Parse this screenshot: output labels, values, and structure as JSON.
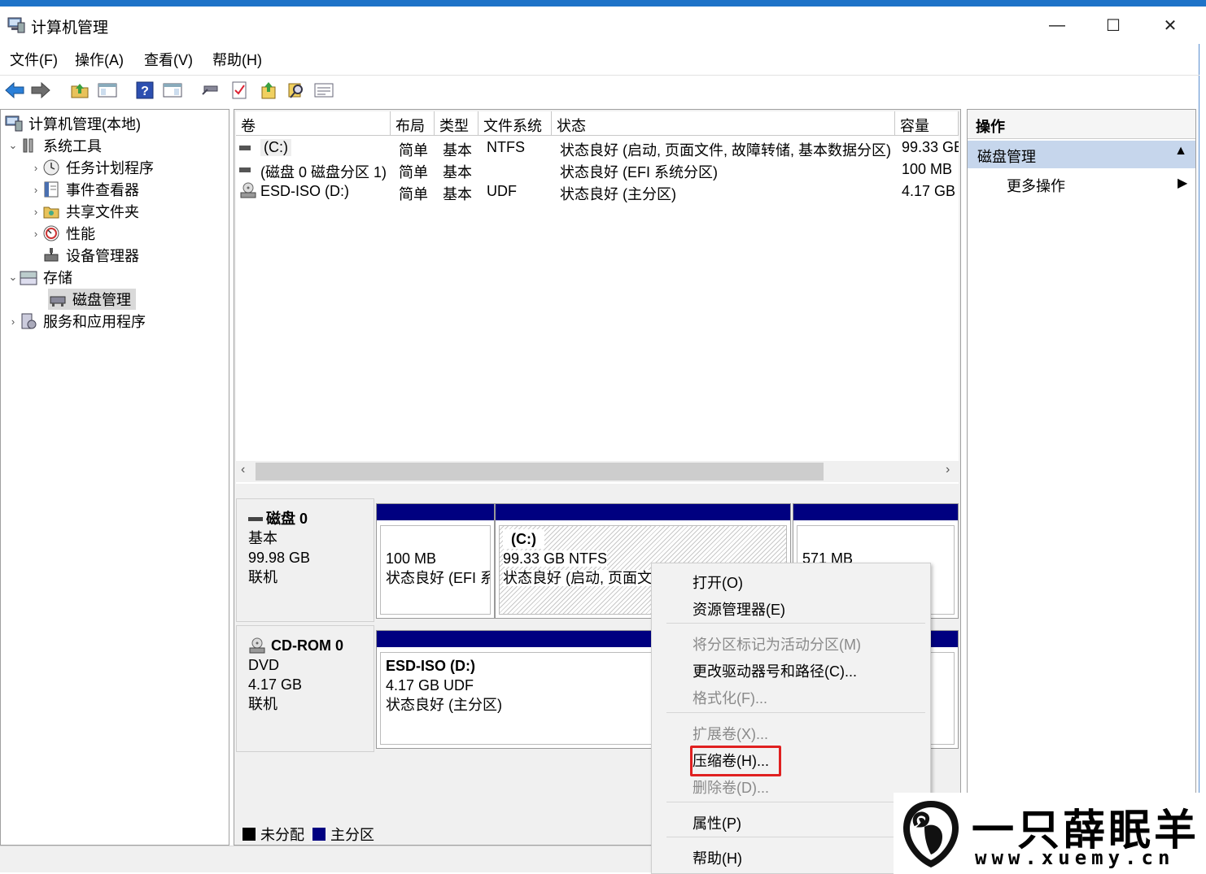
{
  "window": {
    "title": "计算机管理",
    "controls": {
      "minimize": "—",
      "maximize": "☐",
      "close": "✕"
    }
  },
  "menu": [
    "文件(F)",
    "操作(A)",
    "查看(V)",
    "帮助(H)"
  ],
  "toolbar_icons": [
    "back-arrow-icon",
    "forward-arrow-icon",
    "up-folder-icon",
    "show-hide-tree-icon",
    "help-icon",
    "properties-pane-icon",
    "connect-icon",
    "checklist-icon",
    "export-icon",
    "search-icon",
    "view-icon"
  ],
  "tree": {
    "root": "计算机管理(本地)",
    "items": [
      {
        "label": "系统工具",
        "level": 1,
        "expanded": true
      },
      {
        "label": "任务计划程序",
        "level": 2,
        "expanded": false
      },
      {
        "label": "事件查看器",
        "level": 2,
        "expanded": false
      },
      {
        "label": "共享文件夹",
        "level": 2,
        "expanded": false
      },
      {
        "label": "性能",
        "level": 2,
        "expanded": false
      },
      {
        "label": "设备管理器",
        "level": 2,
        "expanded": null
      },
      {
        "label": "存储",
        "level": 1,
        "expanded": true
      },
      {
        "label": "磁盘管理",
        "level": 2,
        "expanded": null,
        "selected": true
      },
      {
        "label": "服务和应用程序",
        "level": 1,
        "expanded": false
      }
    ]
  },
  "volumes": {
    "headers": [
      "卷",
      "布局",
      "类型",
      "文件系统",
      "状态",
      "容量"
    ],
    "rows": [
      {
        "vol": "(C:)",
        "layout": "简单",
        "type": "基本",
        "fs": "NTFS",
        "status": "状态良好 (启动, 页面文件, 故障转储, 基本数据分区)",
        "cap": "99.33 GE"
      },
      {
        "vol": "(磁盘 0 磁盘分区 1)",
        "layout": "简单",
        "type": "基本",
        "fs": "",
        "status": "状态良好 (EFI 系统分区)",
        "cap": "100 MB"
      },
      {
        "vol": "ESD-ISO (D:)",
        "layout": "简单",
        "type": "基本",
        "fs": "UDF",
        "status": "状态良好 (主分区)",
        "cap": "4.17 GB"
      }
    ]
  },
  "disks": [
    {
      "name": "磁盘 0",
      "kind": "基本",
      "size": "99.98 GB",
      "state": "联机",
      "partitions": [
        {
          "title": "",
          "line1": "100 MB",
          "line2": "状态良好 (EFI 系"
        },
        {
          "title": "(C:)",
          "line1": "99.33 GB NTFS",
          "line2": "状态良好 (启动, 页面文"
        },
        {
          "title": "",
          "line1": "571 MB",
          "line2": ""
        }
      ]
    },
    {
      "name": "CD-ROM 0",
      "kind": "DVD",
      "size": "4.17 GB",
      "state": "联机",
      "partitions": [
        {
          "title": "ESD-ISO  (D:)",
          "line1": "4.17 GB UDF",
          "line2": "状态良好 (主分区)"
        }
      ]
    }
  ],
  "legend": [
    {
      "label": "未分配",
      "color": "#000000"
    },
    {
      "label": "主分区",
      "color": "#000080"
    }
  ],
  "actions": {
    "header": "操作",
    "section": "磁盘管理",
    "more": "更多操作"
  },
  "context_menu": [
    {
      "label": "打开(O)",
      "enabled": true
    },
    {
      "label": "资源管理器(E)",
      "enabled": true
    },
    {
      "label": "将分区标记为活动分区(M)",
      "enabled": false
    },
    {
      "label": "更改驱动器号和路径(C)...",
      "enabled": true
    },
    {
      "label": "格式化(F)...",
      "enabled": false
    },
    {
      "label": "扩展卷(X)...",
      "enabled": false
    },
    {
      "label": "压缩卷(H)...",
      "enabled": true,
      "highlighted": true
    },
    {
      "label": "删除卷(D)...",
      "enabled": false
    },
    {
      "label": "属性(P)",
      "enabled": true
    },
    {
      "label": "帮助(H)",
      "enabled": true
    }
  ],
  "watermark": {
    "title": "一只薛眠羊",
    "url": "www.xuemy.cn"
  }
}
